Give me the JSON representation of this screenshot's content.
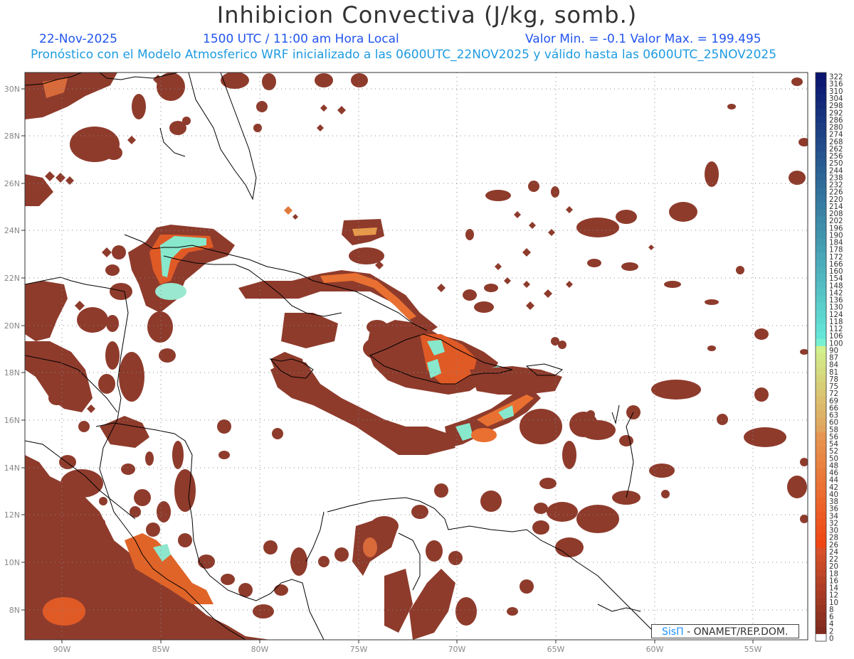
{
  "title": "Inhibicion Convectiva (J/kg, somb.)",
  "date": "22-Nov-2025",
  "time": "1500 UTC / 11:00 am Hora Local",
  "minmax": "Valor Min. = -0.1  Valor Max. = 199.495",
  "forecast": "Pronóstico con el Modelo Atmosferico WRF inicializado a las 0600UTC_22NOV2025 y válido hasta las  0600UTC_25NOV2025",
  "credit_logo": "SisΠ",
  "credit_text": "- ONAMET/REP.DOM.",
  "lat_labels": [
    "30N",
    "28N",
    "26N",
    "24N",
    "22N",
    "20N",
    "18N",
    "16N",
    "14N",
    "12N",
    "10N",
    "8N"
  ],
  "lon_labels": [
    "90W",
    "85W",
    "80W",
    "75W",
    "70W",
    "65W",
    "60W",
    "55W"
  ],
  "colorbar_labels": [
    "322",
    "316",
    "310",
    "304",
    "298",
    "292",
    "286",
    "280",
    "274",
    "268",
    "262",
    "256",
    "250",
    "244",
    "238",
    "232",
    "226",
    "220",
    "214",
    "208",
    "202",
    "196",
    "190",
    "184",
    "178",
    "172",
    "166",
    "160",
    "154",
    "148",
    "142",
    "136",
    "130",
    "124",
    "118",
    "112",
    "106",
    "100",
    "90",
    "87",
    "84",
    "81",
    "78",
    "75",
    "72",
    "69",
    "66",
    "63",
    "60",
    "58",
    "56",
    "54",
    "52",
    "50",
    "48",
    "46",
    "44",
    "42",
    "40",
    "38",
    "36",
    "34",
    "32",
    "30",
    "28",
    "26",
    "24",
    "22",
    "20",
    "18",
    "16",
    "14",
    "12",
    "10",
    "8",
    "6",
    "4",
    "2",
    "0"
  ],
  "colors": {
    "land_low": "#8b3a2a",
    "land_mid": "#e06020",
    "land_high": "#7fe0c8",
    "blue": "#2255ee",
    "cyan": "#1e9be0"
  }
}
